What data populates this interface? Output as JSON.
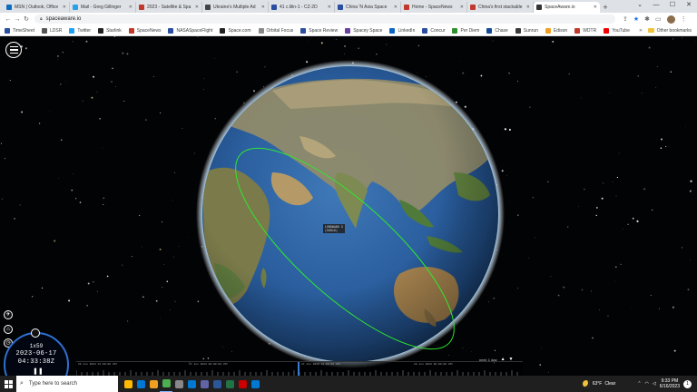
{
  "browser": {
    "tabs": [
      {
        "label": "MSN | Outlook, Office",
        "color": "#0f6cbd"
      },
      {
        "label": "Mail - Greg Gillinger",
        "color": "#2aa0e8"
      },
      {
        "label": "2023 - Satellite & Spa",
        "color": "#c0392b"
      },
      {
        "label": "Ukraine's Multiple Ad",
        "color": "#444"
      },
      {
        "label": "41 c.lilin-1 - CZ-2D",
        "color": "#2a4ea0"
      },
      {
        "label": "China 'N Asia Space",
        "color": "#2a4ea0"
      },
      {
        "label": "Home - SpaceNews",
        "color": "#c0392b"
      },
      {
        "label": "China's first stackable",
        "color": "#c0392b"
      },
      {
        "label": "SpaceAware.io",
        "color": "#333",
        "active": true
      }
    ],
    "new_tab": "+",
    "window_controls": {
      "chevron": "⌄",
      "minimize": "—",
      "maximize": "☐",
      "close": "✕"
    },
    "address": "spaceaware.io",
    "nav": {
      "back": "←",
      "forward": "→",
      "reload": "↻"
    },
    "addr_icons": {
      "share": "⇪",
      "star": "★",
      "ext": "✱",
      "panel": "▭",
      "menu": "⋮"
    }
  },
  "bookmarks": [
    {
      "label": "TimeSheet",
      "color": "#2a4ea0"
    },
    {
      "label": "LDSR",
      "color": "#555"
    },
    {
      "label": "Twitter",
      "color": "#1da1f2"
    },
    {
      "label": "Starlink",
      "color": "#222"
    },
    {
      "label": "SpaceNews",
      "color": "#c0392b"
    },
    {
      "label": "NASASpaceFlight",
      "color": "#2a4ea0"
    },
    {
      "label": "Space.com",
      "color": "#222"
    },
    {
      "label": "Orbital Focus",
      "color": "#888"
    },
    {
      "label": "Space Review",
      "color": "#2a4ea0"
    },
    {
      "label": "Spacey Space",
      "color": "#6b3fa0"
    },
    {
      "label": "LinkedIn",
      "color": "#0a66c2"
    },
    {
      "label": "Concur",
      "color": "#2a4ea0"
    },
    {
      "label": "Per Diem",
      "color": "#2f8f2f"
    },
    {
      "label": "Chase",
      "color": "#124a9b"
    },
    {
      "label": "Sunrun",
      "color": "#3a3a3a"
    },
    {
      "label": "Edison",
      "color": "#f0a020"
    },
    {
      "label": "WDTR",
      "color": "#c0392b"
    },
    {
      "label": "YouTube",
      "color": "#e00"
    }
  ],
  "bookmarks_more": "Other bookmarks",
  "app": {
    "satellite_label_line1": "LONGWANG 3",
    "satellite_label_line2": "(56819)",
    "clock": {
      "rate": "1x59",
      "date": "2023-06-17",
      "time": "04:33:38Z",
      "pause": "❚❚"
    },
    "left_icons": {
      "satellite": "✈",
      "home": "⌂",
      "history": "◷"
    },
    "timeline": {
      "labels": [
        "16 Jun 2023 12:00:00 UTC",
        "17 Jun 2023 00:00:00 UTC",
        "17 Jun 2023 12:00:00 UTC",
        "18 Jun 2023 00:00:00 UTC"
      ],
      "range_label": "next: 1 day",
      "up": "▲",
      "down": "▼"
    },
    "colors": {
      "orbit": "#2ee82e",
      "clock_ring": "#2f6fd0",
      "timeline_cursor": "#3a7bd5"
    }
  },
  "taskbar": {
    "search_placeholder": "Type here to search",
    "apps": [
      {
        "color": "#ffb900"
      },
      {
        "color": "#0078d4"
      },
      {
        "color": "#f0a020"
      },
      {
        "color": "#4caf50",
        "active": true
      },
      {
        "color": "#888"
      },
      {
        "color": "#0078d4"
      },
      {
        "color": "#6264a7"
      },
      {
        "color": "#2b579a"
      },
      {
        "color": "#217346"
      },
      {
        "color": "#cc0000"
      },
      {
        "color": "#0078d4"
      }
    ],
    "weather": {
      "temp": "63°F",
      "condition": "Clear"
    },
    "time": "9:33 PM",
    "date": "6/16/2023",
    "notifications": "1"
  }
}
